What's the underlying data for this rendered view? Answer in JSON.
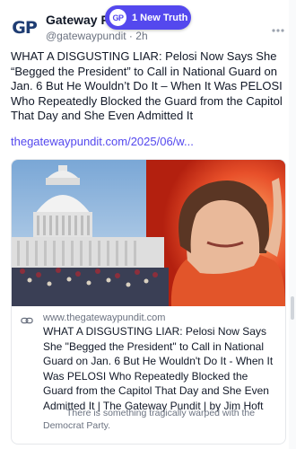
{
  "author": {
    "avatar_text": "GP",
    "name": "Gateway Pundit",
    "handle": "@gatewaypundit",
    "time": "2h"
  },
  "new_truth_pill": {
    "logo_text": "GP",
    "label": "1 New Truth"
  },
  "post": {
    "text": "WHAT A DISGUSTING LIAR: Pelosi Now Says She “Begged the President” to Call in National Guard on Jan. 6 But He Wouldn’t Do It – When It Was PELOSI Who Repeatedly Blocked the Guard from the Capitol That Day and She Even Admitted It",
    "link": "thegatewaypundit.com/2025/06/w..."
  },
  "link_card": {
    "domain": "www.thegatewaypundit.com",
    "title": "WHAT A DISGUSTING LIAR: Pelosi Now Says She \"Begged the President\" to Call in National Guard on Jan. 6 But He Wouldn't Do It - When It Was PELOSI Who Repeatedly Blocked the Guard from the Capitol That Day and She Even Admitted It | The Gateway Pundit | by Jim Hoft",
    "description": "There is something tragically warped with the Democrat Party."
  },
  "colors": {
    "accent": "#5448ee",
    "text_primary": "#111827",
    "text_secondary": "#6b7280",
    "border": "#e5e7eb"
  },
  "icons": [
    "more-icon",
    "link-icon"
  ]
}
